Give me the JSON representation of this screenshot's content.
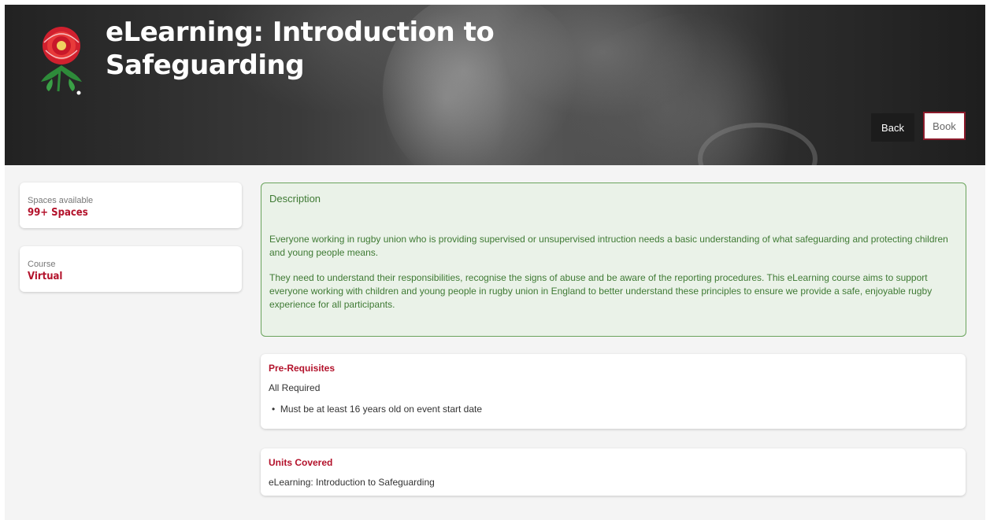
{
  "header": {
    "title": "eLearning: Introduction to Safeguarding",
    "back_label": "Back",
    "book_label": "Book"
  },
  "sidebar": {
    "spaces": {
      "label": "Spaces available",
      "value": "99+ Spaces"
    },
    "course": {
      "label": "Course",
      "value": "Virtual"
    }
  },
  "description": {
    "heading": "Description",
    "paragraphs": [
      "Everyone working in rugby union who is providing supervised or unsupervised intruction needs a basic understanding of what safeguarding and protecting children and young people means.",
      "They need to understand their responsibilities, recognise the signs of abuse and be aware of the reporting procedures. This eLearning course aims to support everyone working with children and young people in rugby union in England to better understand these principles to ensure we provide a safe, enjoyable rugby experience for all participants."
    ]
  },
  "prerequisites": {
    "heading": "Pre-Requisites",
    "subheading": "All Required",
    "items": [
      "Must be at least 16 years old on event start date"
    ]
  },
  "units": {
    "heading": "Units Covered",
    "items": [
      "eLearning: Introduction to Safeguarding"
    ]
  },
  "colors": {
    "accent": "#b3122b",
    "book_border": "#8b1a2b",
    "description_bg": "#eaf2e8",
    "description_text": "#3f7a34"
  },
  "icons": {
    "logo": "england-rose-icon"
  }
}
